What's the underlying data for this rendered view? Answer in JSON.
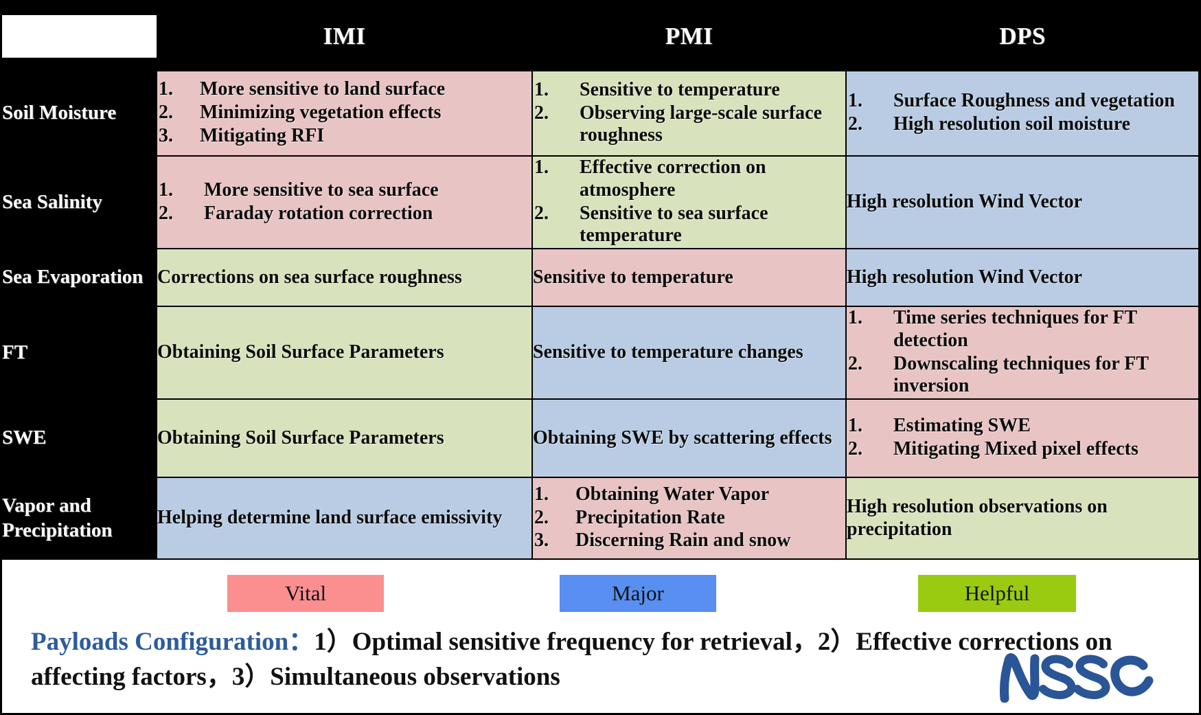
{
  "table": {
    "corner_blank": "",
    "columns": [
      "IMI",
      "PMI",
      "DPS"
    ],
    "rows": [
      {
        "label": "Soil Moisture",
        "cells": [
          {
            "level": "Vital",
            "items": [
              "More sensitive to land surface",
              "Minimizing vegetation effects",
              "Mitigating RFI"
            ]
          },
          {
            "level": "Helpful",
            "items": [
              "Sensitive to temperature",
              "Observing  large-scale surface roughness"
            ]
          },
          {
            "level": "Major",
            "items": [
              "Surface Roughness and vegetation",
              "High resolution soil moisture"
            ]
          }
        ]
      },
      {
        "label": "Sea Salinity",
        "cells": [
          {
            "level": "Vital",
            "items": [
              "More sensitive to sea surface",
              "Faraday rotation correction"
            ]
          },
          {
            "level": "Helpful",
            "items": [
              "Effective correction on atmosphere",
              "Sensitive to sea surface temperature"
            ]
          },
          {
            "level": "Major",
            "text": "High resolution Wind Vector"
          }
        ]
      },
      {
        "label": "Sea Evaporation",
        "cells": [
          {
            "level": "Helpful",
            "text": "Corrections on sea surface roughness"
          },
          {
            "level": "Vital",
            "text": "Sensitive to temperature"
          },
          {
            "level": "Major",
            "text": "High resolution Wind Vector"
          }
        ]
      },
      {
        "label": "FT",
        "cells": [
          {
            "level": "Helpful",
            "text": "Obtaining Soil Surface Parameters"
          },
          {
            "level": "Major",
            "text": "Sensitive to temperature changes"
          },
          {
            "level": "Vital",
            "items": [
              "Time series techniques for FT detection",
              "Downscaling techniques for FT inversion"
            ]
          }
        ]
      },
      {
        "label": "SWE",
        "cells": [
          {
            "level": "Helpful",
            "text": "Obtaining Soil Surface Parameters"
          },
          {
            "level": "Major",
            "text": "Obtaining SWE by scattering effects"
          },
          {
            "level": "Vital",
            "items": [
              "Estimating SWE",
              "Mitigating Mixed pixel effects"
            ]
          }
        ]
      },
      {
        "label": "Vapor and Precipitation",
        "cells": [
          {
            "level": "Major",
            "text": " Helping determine land surface emissivity"
          },
          {
            "level": "Vital",
            "items": [
              "Obtaining Water Vapor",
              "Precipitation Rate",
              "Discerning Rain and snow"
            ]
          },
          {
            "level": "Helpful",
            "text": "High resolution observations on precipitation"
          }
        ]
      }
    ]
  },
  "legend": {
    "vital": "Vital",
    "major": "Major",
    "helpful": "Helpful"
  },
  "footer": {
    "lead": "Payloads Configuration：",
    "body": "1）Optimal sensitive frequency for retrieval，2）Effective corrections on affecting factors，3）Simultaneous observations",
    "logo_text": "NSSC"
  },
  "colors": {
    "vital_cell": "#e9c4c4",
    "helpful_cell": "#d8e3bd",
    "major_cell": "#b9cce4",
    "vital_chip": "#fb8f8f",
    "major_chip": "#588ff0",
    "helpful_chip": "#9bcb10",
    "header_bg": "#000000",
    "header_text": "#ffffff",
    "lead_text": "#2d5b9e",
    "logo": "#2a5596"
  }
}
